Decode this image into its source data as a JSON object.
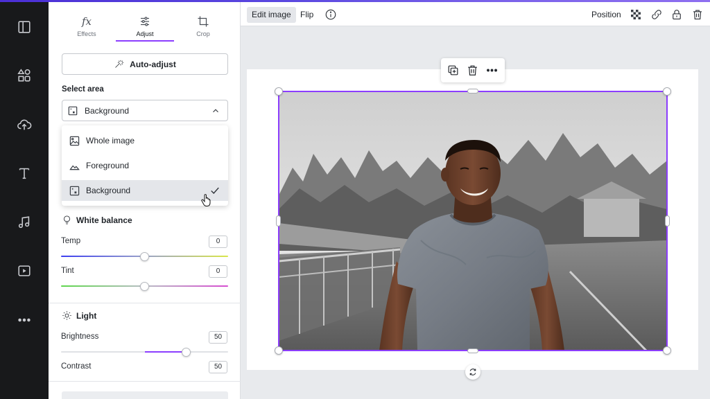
{
  "tabs": [
    {
      "label": "Effects",
      "icon": "fx-icon"
    },
    {
      "label": "Adjust",
      "icon": "sliders-icon"
    },
    {
      "label": "Crop",
      "icon": "crop-icon"
    }
  ],
  "auto_adjust_label": "Auto-adjust",
  "select_area": {
    "label": "Select area",
    "selected": "Background",
    "options": [
      {
        "label": "Whole image",
        "selected": false
      },
      {
        "label": "Foreground",
        "selected": false
      },
      {
        "label": "Background",
        "selected": true
      }
    ]
  },
  "white_balance": {
    "title": "White balance",
    "temp": {
      "label": "Temp",
      "value": "0",
      "fraction": 0.5
    },
    "tint": {
      "label": "Tint",
      "value": "0",
      "fraction": 0.5
    }
  },
  "light": {
    "title": "Light",
    "brightness": {
      "label": "Brightness",
      "value": "50",
      "fraction": 0.75
    },
    "contrast": {
      "label": "Contrast",
      "value": "50"
    }
  },
  "toolbar": {
    "edit_image": "Edit image",
    "flip": "Flip",
    "position": "Position"
  },
  "colors": {
    "accent": "#8b3dff",
    "rail_bg": "#18191b",
    "canvas_bg": "#e8eaed"
  }
}
